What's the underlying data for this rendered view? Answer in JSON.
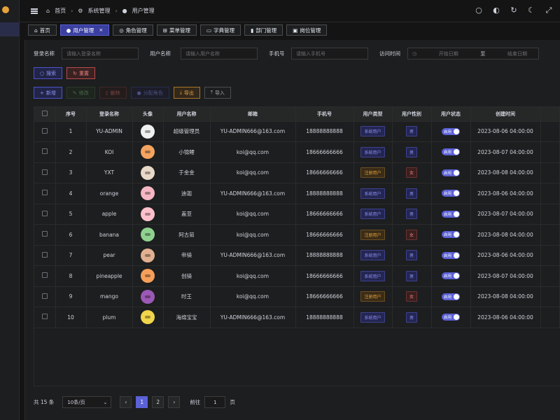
{
  "breadcrumbs": [
    "首页",
    "系统管理",
    "用户管理"
  ],
  "tabs": [
    {
      "label": "首页",
      "icon": "home-icon"
    },
    {
      "label": "用户管理",
      "icon": "user-icon",
      "active": true
    },
    {
      "label": "角色管理",
      "icon": "role-icon"
    },
    {
      "label": "菜单管理",
      "icon": "grid-icon"
    },
    {
      "label": "字典管理",
      "icon": "book-icon"
    },
    {
      "label": "部门管理",
      "icon": "chart-icon"
    },
    {
      "label": "岗位管理",
      "icon": "post-icon"
    }
  ],
  "search": {
    "login_label": "登录名称",
    "login_placeholder": "请输入登录名称",
    "name_label": "用户名称",
    "name_placeholder": "请输入用户名称",
    "phone_label": "手机号",
    "phone_placeholder": "请输入手机号",
    "time_label": "访问时间",
    "start_placeholder": "开始日期",
    "range_sep": "至",
    "end_placeholder": "结束日期",
    "search_btn": "搜索",
    "reset_btn": "重置"
  },
  "toolbar": {
    "add": "新增",
    "edit": "修改",
    "delete": "删除",
    "assign": "分配角色",
    "export": "导出",
    "import": "导入"
  },
  "table": {
    "headers": [
      "序号",
      "登录名称",
      "头像",
      "用户名称",
      "邮箱",
      "手机号",
      "用户类型",
      "用户性别",
      "用户状态",
      "创建时间"
    ],
    "rows": [
      {
        "no": "1",
        "login": "YU-ADMIN",
        "avatar": "#f0f0f0",
        "name": "超级管理员",
        "email": "YU-ADMIN666@163.com",
        "phone": "18888888888",
        "type": "系统用户",
        "type_kind": "sys",
        "gender": "男",
        "gender_kind": "male",
        "status": "启用",
        "created": "2023-08-06 04:00:00"
      },
      {
        "no": "2",
        "login": "KOI",
        "avatar": "#f4a460",
        "name": "小锦鲤",
        "email": "koi@qq.com",
        "phone": "18666666666",
        "type": "系统用户",
        "type_kind": "sys",
        "gender": "男",
        "gender_kind": "male",
        "status": "启用",
        "created": "2023-08-07 04:00:00"
      },
      {
        "no": "3",
        "login": "YXT",
        "avatar": "#e8d8c8",
        "name": "于金金",
        "email": "koi@qq.com",
        "phone": "18666666666",
        "type": "注册用户",
        "type_kind": "reg",
        "gender": "女",
        "gender_kind": "female",
        "status": "启用",
        "created": "2023-08-08 04:00:00"
      },
      {
        "no": "4",
        "login": "orange",
        "avatar": "#f4b6c2",
        "name": "迪迦",
        "email": "YU-ADMIN666@163.com",
        "phone": "18888888888",
        "type": "系统用户",
        "type_kind": "sys",
        "gender": "男",
        "gender_kind": "male",
        "status": "启用",
        "created": "2023-08-06 04:00:00"
      },
      {
        "no": "5",
        "login": "apple",
        "avatar": "#ffc0cb",
        "name": "盖亚",
        "email": "koi@qq.com",
        "phone": "18666666666",
        "type": "系统用户",
        "type_kind": "sys",
        "gender": "男",
        "gender_kind": "male",
        "status": "启用",
        "created": "2023-08-07 04:00:00"
      },
      {
        "no": "6",
        "login": "banana",
        "avatar": "#8fd18f",
        "name": "阿古茹",
        "email": "koi@qq.com",
        "phone": "18666666666",
        "type": "注册用户",
        "type_kind": "reg",
        "gender": "女",
        "gender_kind": "female",
        "status": "启用",
        "created": "2023-08-08 04:00:00"
      },
      {
        "no": "7",
        "login": "pear",
        "avatar": "#e0b090",
        "name": "帝骑",
        "email": "YU-ADMIN666@163.com",
        "phone": "18888888888",
        "type": "系统用户",
        "type_kind": "sys",
        "gender": "男",
        "gender_kind": "male",
        "status": "启用",
        "created": "2023-08-06 04:00:00"
      },
      {
        "no": "8",
        "login": "pineapple",
        "avatar": "#f5a05a",
        "name": "创骑",
        "email": "koi@qq.com",
        "phone": "18666666666",
        "type": "系统用户",
        "type_kind": "sys",
        "gender": "男",
        "gender_kind": "male",
        "status": "启用",
        "created": "2023-08-07 04:00:00"
      },
      {
        "no": "9",
        "login": "mango",
        "avatar": "#9b59b6",
        "name": "时王",
        "email": "koi@qq.com",
        "phone": "18666666666",
        "type": "注册用户",
        "type_kind": "reg",
        "gender": "女",
        "gender_kind": "female",
        "status": "启用",
        "created": "2023-08-08 04:00:00"
      },
      {
        "no": "10",
        "login": "plum",
        "avatar": "#f1d54a",
        "name": "海绵宝宝",
        "email": "YU-ADMIN666@163.com",
        "phone": "18888888888",
        "type": "系统用户",
        "type_kind": "sys",
        "gender": "男",
        "gender_kind": "male",
        "status": "启用",
        "created": "2023-08-06 04:00:00"
      }
    ]
  },
  "pagination": {
    "total": "共 15 条",
    "page_size": "10条/页",
    "pages": [
      "1",
      "2"
    ],
    "current": "1",
    "goto_label": "前往",
    "goto_value": "1",
    "goto_suffix": "页"
  }
}
